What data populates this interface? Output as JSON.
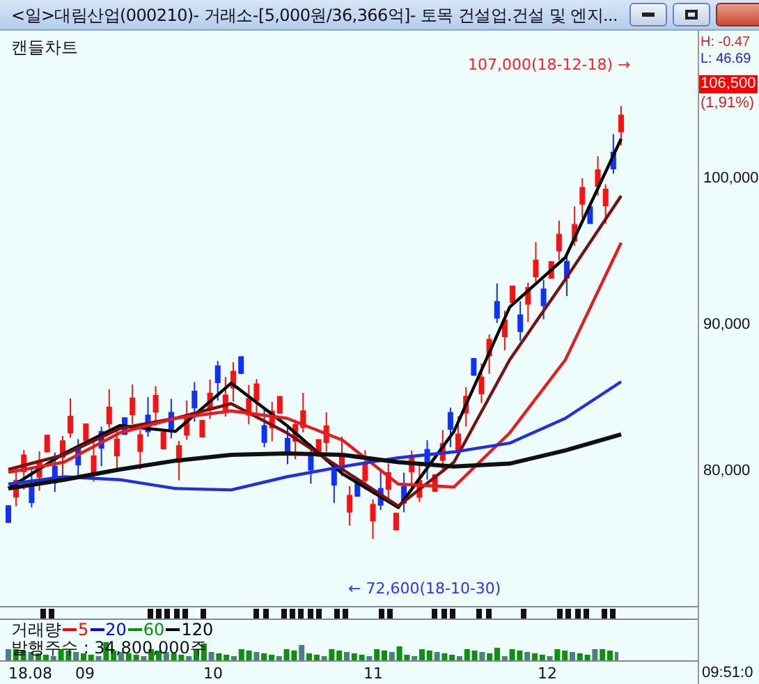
{
  "window": {
    "title": "<일>대림산업(000210)- 거래소-[5,000원/36,366억]- 토목 건설업.건설 및 엔지..."
  },
  "chart_panel": {
    "label": "캔들차트",
    "high_note": "107,000(18-12-18) →",
    "low_note": "← 72,600(18-10-30)"
  },
  "price_axis": {
    "high": "H: -0.47",
    "low": "L: 46.69",
    "current_price": "106,500",
    "current_change": "(1,91%)",
    "labels": [
      "100,000",
      "90,000",
      "80,000"
    ]
  },
  "volume_panel": {
    "label": "거래량",
    "legend": [
      {
        "label": "5",
        "color": "#ff0000"
      },
      {
        "label": "20",
        "color": "#0000ff"
      },
      {
        "label": "60",
        "color": "#009000"
      },
      {
        "label": "120",
        "color": "#000000"
      }
    ],
    "shares": "발행주수 : 34,800,000주"
  },
  "date_axis": {
    "labels": [
      "18.08",
      "09",
      "10",
      "11",
      "12"
    ]
  },
  "status": {
    "time": "09:51:0"
  }
}
